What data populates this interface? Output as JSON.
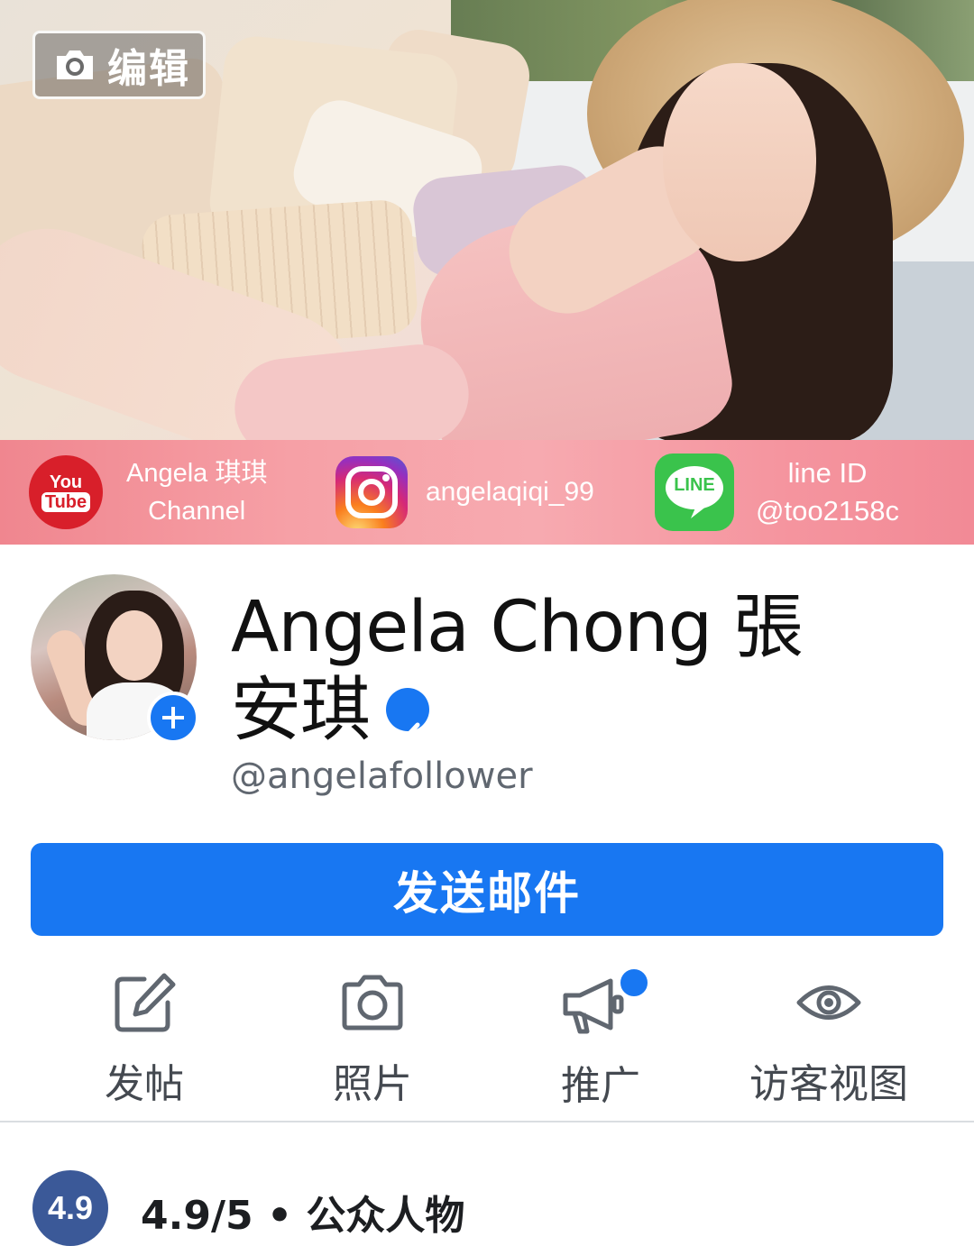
{
  "cover": {
    "edit_label": "编辑",
    "social": {
      "youtube": {
        "logo_top": "You",
        "logo_bottom": "Tube",
        "line1": "Angela 琪琪",
        "line2": "Channel"
      },
      "instagram": {
        "handle": "angelaqiqi_99"
      },
      "line": {
        "logo_text": "LINE",
        "line1": "line ID",
        "line2": "@too2158c"
      }
    }
  },
  "profile": {
    "name": "Angela Chong 張安琪",
    "username": "@angelafollower",
    "verified": true
  },
  "cta": {
    "label": "发送邮件"
  },
  "actions": [
    {
      "label": "发帖",
      "icon": "compose-icon"
    },
    {
      "label": "照片",
      "icon": "camera-icon"
    },
    {
      "label": "推广",
      "icon": "megaphone-icon",
      "has_badge": true
    },
    {
      "label": "访客视图",
      "icon": "eye-icon"
    }
  ],
  "rating": {
    "badge": "4.9",
    "text": "4.9/5 • 公众人物"
  },
  "colors": {
    "facebook_blue": "#1877f2",
    "strip_pink": "#f6a0a6"
  }
}
